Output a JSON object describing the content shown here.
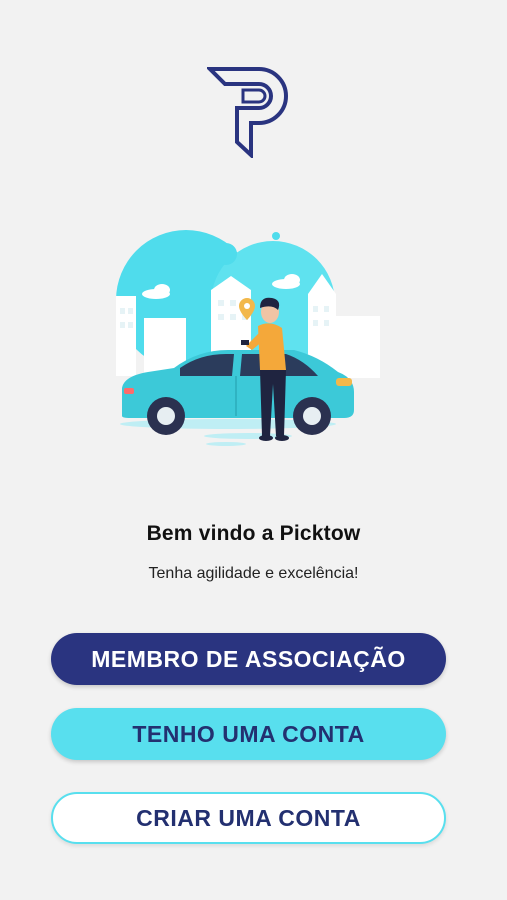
{
  "brand": {
    "logo_icon": "picktow-p-logo-icon",
    "primary_color": "#2a3480",
    "accent_color": "#58dfee"
  },
  "hero": {
    "illustration_icon": "car-person-city-illustration-icon"
  },
  "welcome": {
    "title": "Bem vindo a Picktow",
    "subtitle": "Tenha agilidade e excelência!"
  },
  "buttons": {
    "member_label": "MEMBRO DE ASSOCIAÇÃO",
    "login_label": "TENHO UMA CONTA",
    "signup_label": "CRIAR UMA CONTA"
  }
}
